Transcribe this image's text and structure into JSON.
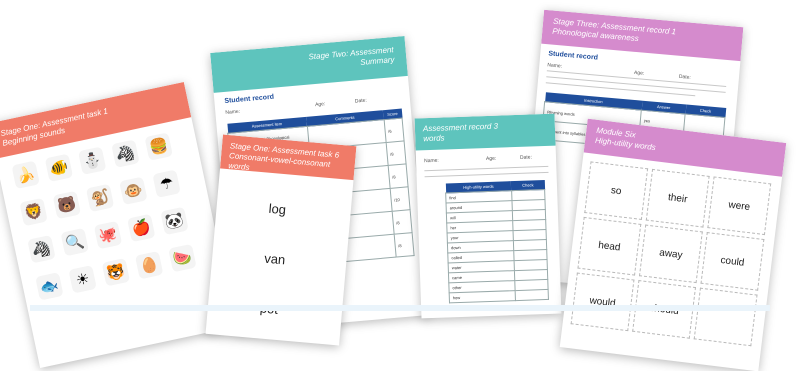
{
  "stage_three": {
    "title1": "Stage Three: Assessment record 1",
    "title2": "Phonological awareness",
    "student_record": "Student record",
    "name_label": "Name:",
    "age_label": "Age:",
    "date_label": "Date:",
    "col_instruction": "Instruction",
    "col_answer": "Answer",
    "col_check": "Check",
    "row1": "Rhyming words",
    "row2": "Segment into syllables",
    "answer1": "yes"
  },
  "stage_two": {
    "title1": "Stage Two: Assessment",
    "title2": "Summary",
    "student_record": "Student record",
    "name_label": "Name:",
    "age_label": "Age:",
    "date_label": "Date:",
    "col_item": "Assessment item",
    "col_comments": "Comments",
    "col_score": "Score",
    "row1": "Assessment task 1 Phonological awareness",
    "score1": "/6",
    "score2": "/8",
    "score3": "/8",
    "score4": "/10",
    "score5": "/8",
    "score6": "/8"
  },
  "hfw_record": {
    "title1": "Assessment record 3",
    "title2": "words",
    "name_label": "Name:",
    "age_label": "Age:",
    "date_label": "Date:",
    "col_word": "High-utility words",
    "col_check": "Check",
    "words": [
      "find",
      "around",
      "will",
      "her",
      "your",
      "down",
      "called",
      "water",
      "came",
      "other",
      "how"
    ]
  },
  "stage_one_task1": {
    "title1": "Stage One: Assessment task 1",
    "title2": "Beginning sounds",
    "pics": [
      "🍌",
      "🐠",
      "⛄",
      "🦓",
      "🍔",
      "🦁",
      "🐻",
      "🐒",
      "🐵",
      "☂",
      "🎻",
      "🦓",
      "🔍",
      "🐙",
      "🍎",
      "🐼",
      "👑",
      "🐟",
      "☀",
      "🐯",
      "🥚",
      "🍉"
    ]
  },
  "stage_one_task6": {
    "title1": "Stage One: Assessment task 6",
    "title2": "Consonant-vowel-consonant words",
    "words": [
      "log",
      "van",
      "pot"
    ]
  },
  "module_six": {
    "title1": "Module Six",
    "title2": "High-utility words",
    "words": [
      "so",
      "their",
      "were",
      "head",
      "away",
      "could",
      "would",
      "should"
    ]
  },
  "colors": {
    "salmon": "#f07b68",
    "teal": "#5ec4bd",
    "pink": "#d58bcd",
    "navy": "#1f4e9c"
  }
}
